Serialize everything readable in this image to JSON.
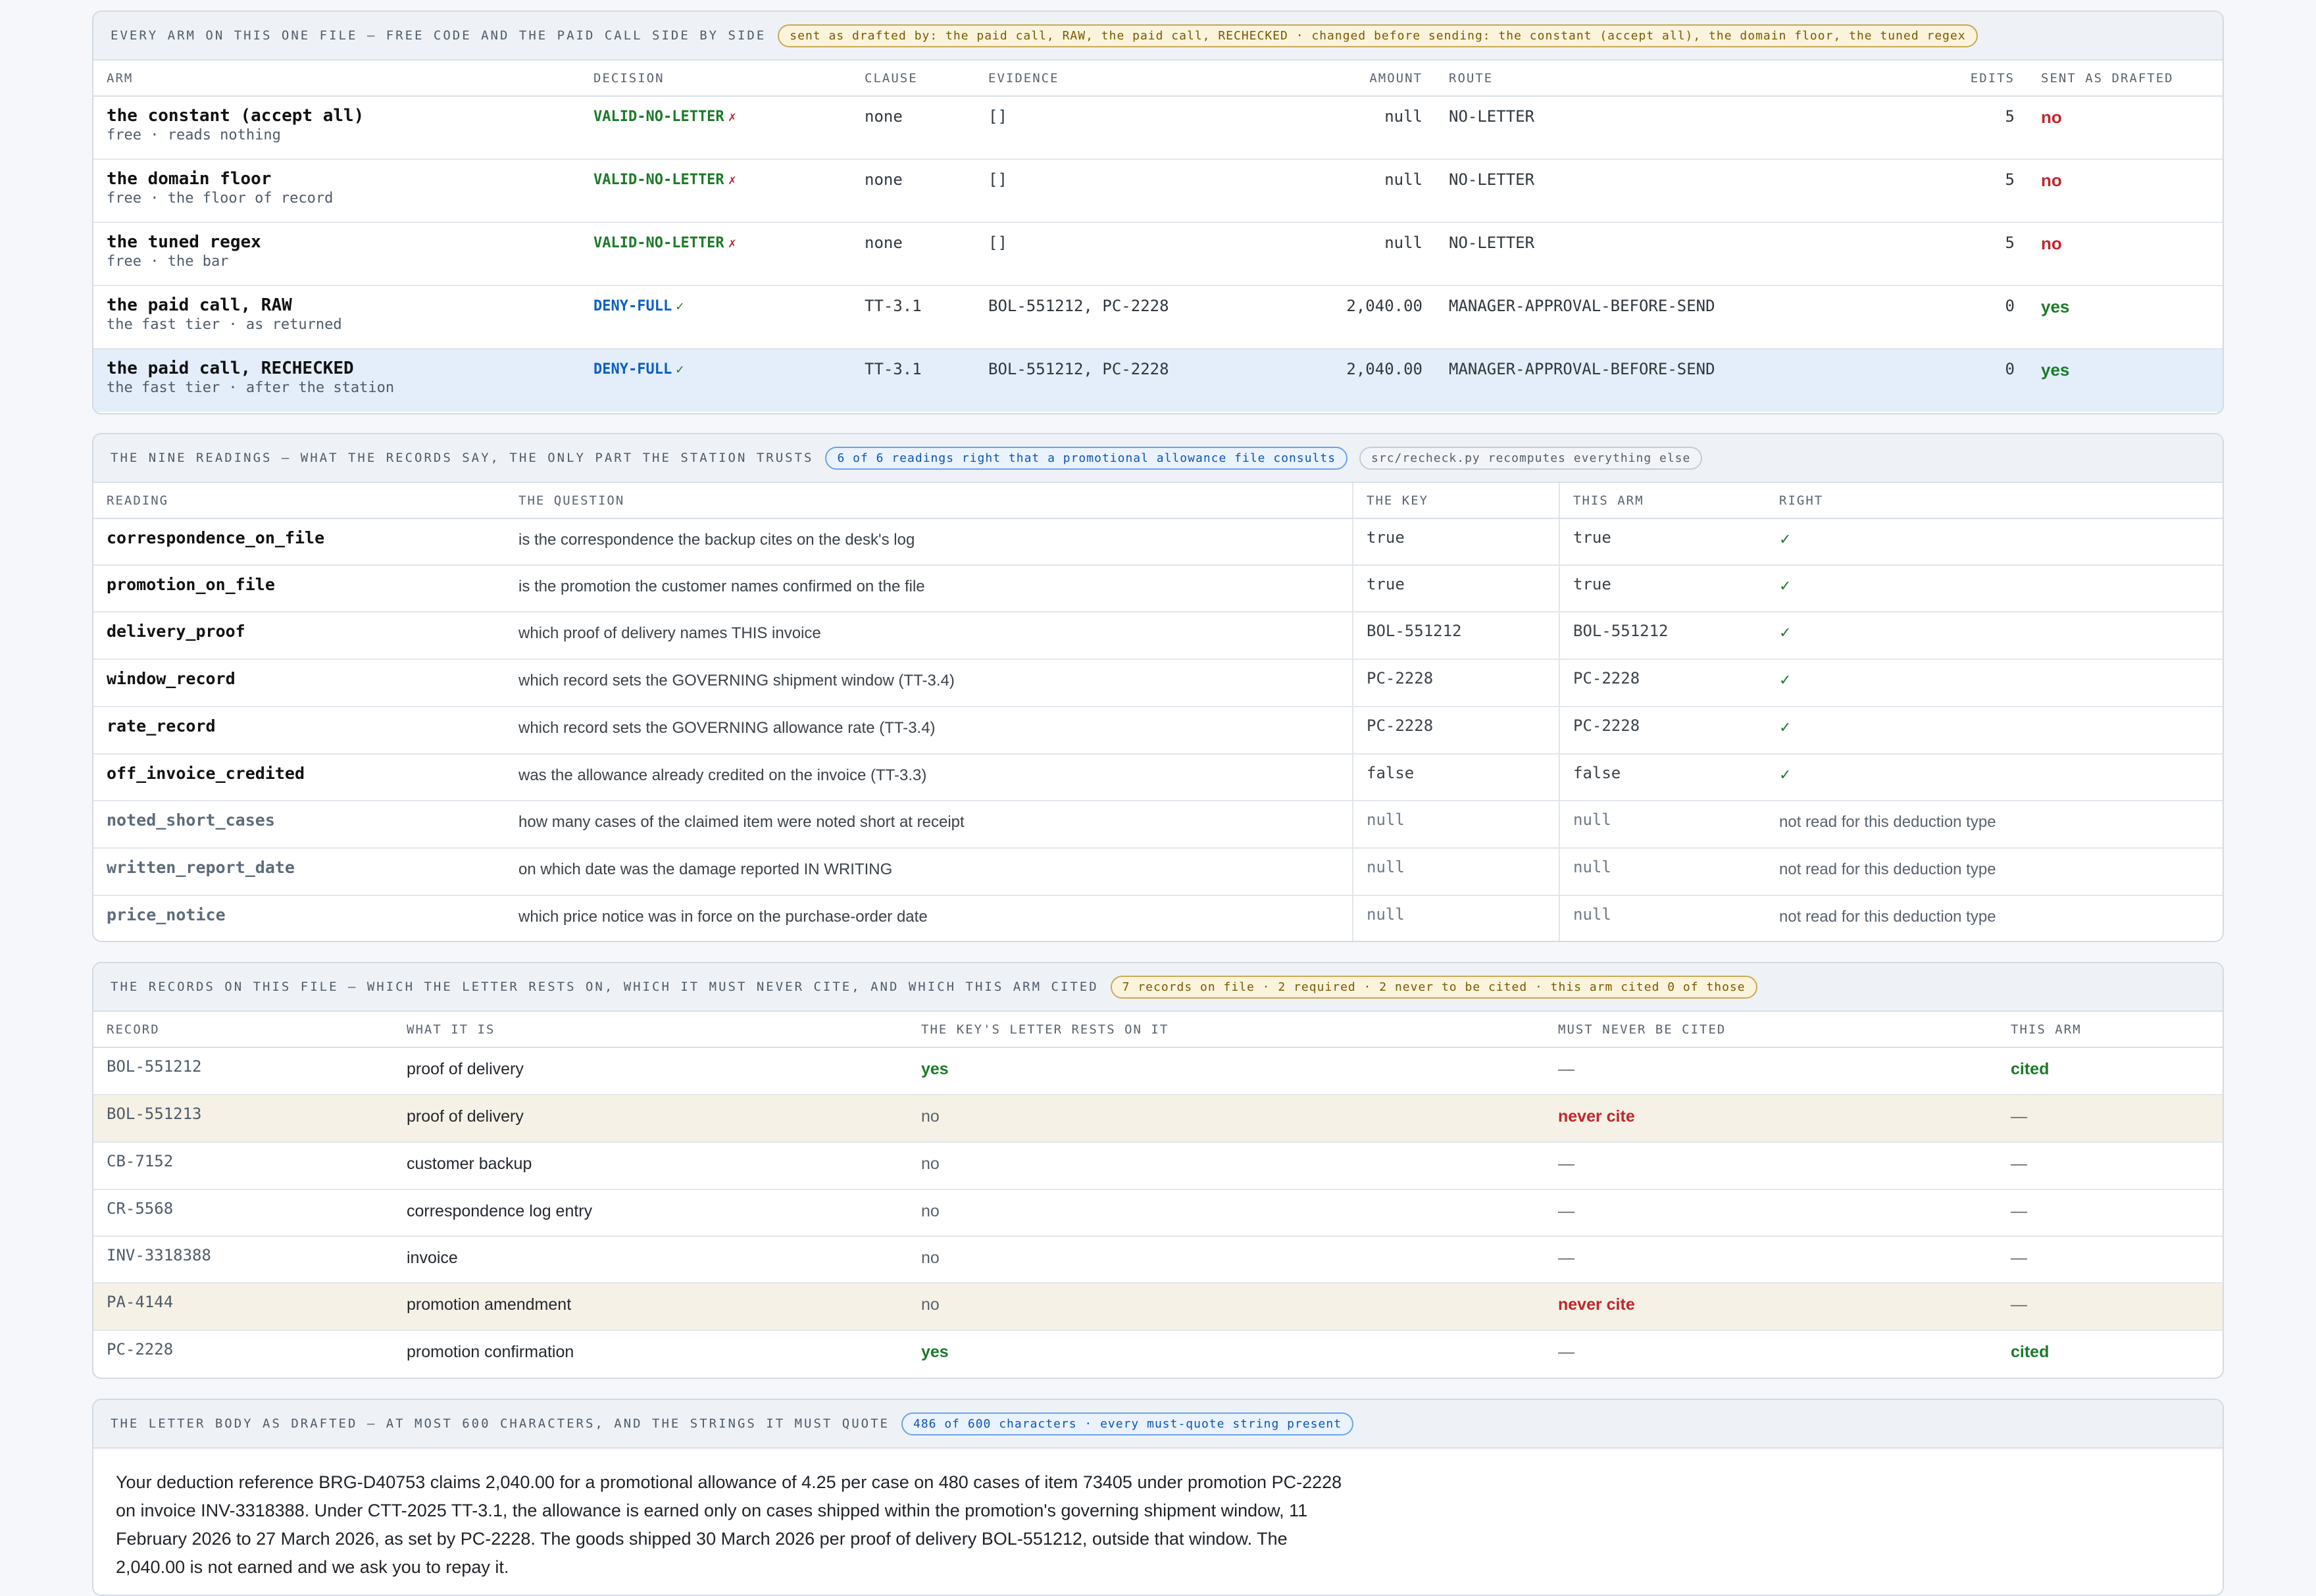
{
  "arms_panel": {
    "title": "EVERY ARM ON THIS ONE FILE — FREE CODE AND THE PAID CALL SIDE BY SIDE",
    "pill": "sent as drafted by: the paid call, RAW, the paid call, RECHECKED · changed before sending: the constant (accept all), the domain floor, the tuned regex",
    "columns": [
      "ARM",
      "DECISION",
      "CLAUSE",
      "EVIDENCE",
      "AMOUNT",
      "ROUTE",
      "EDITS",
      "SENT AS DRAFTED"
    ],
    "rows": [
      {
        "name": "the constant (accept all)",
        "sub": "free · reads nothing",
        "decision": "VALID-NO-LETTER",
        "mark": "✗",
        "clause": "none",
        "evidence": "[]",
        "amount": "null",
        "route": "NO-LETTER",
        "edits": "5",
        "sent": "no"
      },
      {
        "name": "the domain floor",
        "sub": "free · the floor of record",
        "decision": "VALID-NO-LETTER",
        "mark": "✗",
        "clause": "none",
        "evidence": "[]",
        "amount": "null",
        "route": "NO-LETTER",
        "edits": "5",
        "sent": "no"
      },
      {
        "name": "the tuned regex",
        "sub": "free · the bar",
        "decision": "VALID-NO-LETTER",
        "mark": "✗",
        "clause": "none",
        "evidence": "[]",
        "amount": "null",
        "route": "NO-LETTER",
        "edits": "5",
        "sent": "no"
      },
      {
        "name": "the paid call, RAW",
        "sub": "the fast tier · as returned",
        "decision": "DENY-FULL",
        "mark": "✓",
        "clause": "TT-3.1",
        "evidence": "BOL-551212, PC-2228",
        "amount": "2,040.00",
        "route": "MANAGER-APPROVAL-BEFORE-SEND",
        "edits": "0",
        "sent": "yes"
      },
      {
        "name": "the paid call, RECHECKED",
        "sub": "the fast tier · after the station",
        "decision": "DENY-FULL",
        "mark": "✓",
        "clause": "TT-3.1",
        "evidence": "BOL-551212, PC-2228",
        "amount": "2,040.00",
        "route": "MANAGER-APPROVAL-BEFORE-SEND",
        "edits": "0",
        "sent": "yes"
      }
    ]
  },
  "readings_panel": {
    "title": "THE NINE READINGS — WHAT THE RECORDS SAY, THE ONLY PART THE STATION TRUSTS",
    "pill_blue": "6 of 6 readings right that a promotional allowance file consults",
    "pill_grey": "src/recheck.py recomputes everything else",
    "columns": [
      "READING",
      "THE QUESTION",
      "THE KEY",
      "THIS ARM",
      "RIGHT"
    ],
    "rows": [
      {
        "name": "correspondence_on_file",
        "question": "is the correspondence the backup cites on the desk's log",
        "key": "true",
        "arm": "true",
        "right": "✓"
      },
      {
        "name": "promotion_on_file",
        "question": "is the promotion the customer names confirmed on the file",
        "key": "true",
        "arm": "true",
        "right": "✓"
      },
      {
        "name": "delivery_proof",
        "question": "which proof of delivery names THIS invoice",
        "key": "BOL-551212",
        "arm": "BOL-551212",
        "right": "✓"
      },
      {
        "name": "window_record",
        "question": "which record sets the GOVERNING shipment window (TT-3.4)",
        "key": "PC-2228",
        "arm": "PC-2228",
        "right": "✓"
      },
      {
        "name": "rate_record",
        "question": "which record sets the GOVERNING allowance rate (TT-3.4)",
        "key": "PC-2228",
        "arm": "PC-2228",
        "right": "✓"
      },
      {
        "name": "off_invoice_credited",
        "question": "was the allowance already credited on the invoice (TT-3.3)",
        "key": "false",
        "arm": "false",
        "right": "✓"
      },
      {
        "name": "noted_short_cases",
        "question": "how many cases of the claimed item were noted short at receipt",
        "key": "null",
        "arm": "null",
        "right": "not read for this deduction type"
      },
      {
        "name": "written_report_date",
        "question": "on which date was the damage reported IN WRITING",
        "key": "null",
        "arm": "null",
        "right": "not read for this deduction type"
      },
      {
        "name": "price_notice",
        "question": "which price notice was in force on the purchase-order date",
        "key": "null",
        "arm": "null",
        "right": "not read for this deduction type"
      }
    ]
  },
  "records_panel": {
    "title": "THE RECORDS ON THIS FILE — WHICH THE LETTER RESTS ON, WHICH IT MUST NEVER CITE, AND WHICH THIS ARM CITED",
    "pill": "7 records on file · 2 required · 2 never to be cited · this arm cited 0 of those",
    "columns": [
      "RECORD",
      "WHAT IT IS",
      "THE KEY'S LETTER RESTS ON IT",
      "MUST NEVER BE CITED",
      "THIS ARM"
    ],
    "rows": [
      {
        "id": "BOL-551212",
        "what": "proof of delivery",
        "rests": "yes",
        "never": "—",
        "arm": "cited"
      },
      {
        "id": "BOL-551213",
        "what": "proof of delivery",
        "rests": "no",
        "never": "never cite",
        "arm": "—"
      },
      {
        "id": "CB-7152",
        "what": "customer backup",
        "rests": "no",
        "never": "—",
        "arm": "—"
      },
      {
        "id": "CR-5568",
        "what": "correspondence log entry",
        "rests": "no",
        "never": "—",
        "arm": "—"
      },
      {
        "id": "INV-3318388",
        "what": "invoice",
        "rests": "no",
        "never": "—",
        "arm": "—"
      },
      {
        "id": "PA-4144",
        "what": "promotion amendment",
        "rests": "no",
        "never": "never cite",
        "arm": "—"
      },
      {
        "id": "PC-2228",
        "what": "promotion confirmation",
        "rests": "yes",
        "never": "—",
        "arm": "cited"
      }
    ]
  },
  "letter_panel": {
    "title": "THE LETTER BODY AS DRAFTED — AT MOST 600 CHARACTERS, AND THE STRINGS IT MUST QUOTE",
    "pill": "486 of 600 characters · every must-quote string present",
    "body": "Your deduction reference BRG-D40753 claims 2,040.00 for a promotional allowance of 4.25 per case on 480 cases of item 73405 under promotion PC-2228 on invoice INV-3318388. Under CTT-2025 TT-3.1, the allowance is earned only on cases shipped within the promotion's governing shipment window, 11 February 2026 to 27 March 2026, as set by PC-2228. The goods shipped 30 March 2026 per proof of delivery BOL-551212, outside that window. The 2,040.00 is not earned and we ask you to repay it."
  }
}
